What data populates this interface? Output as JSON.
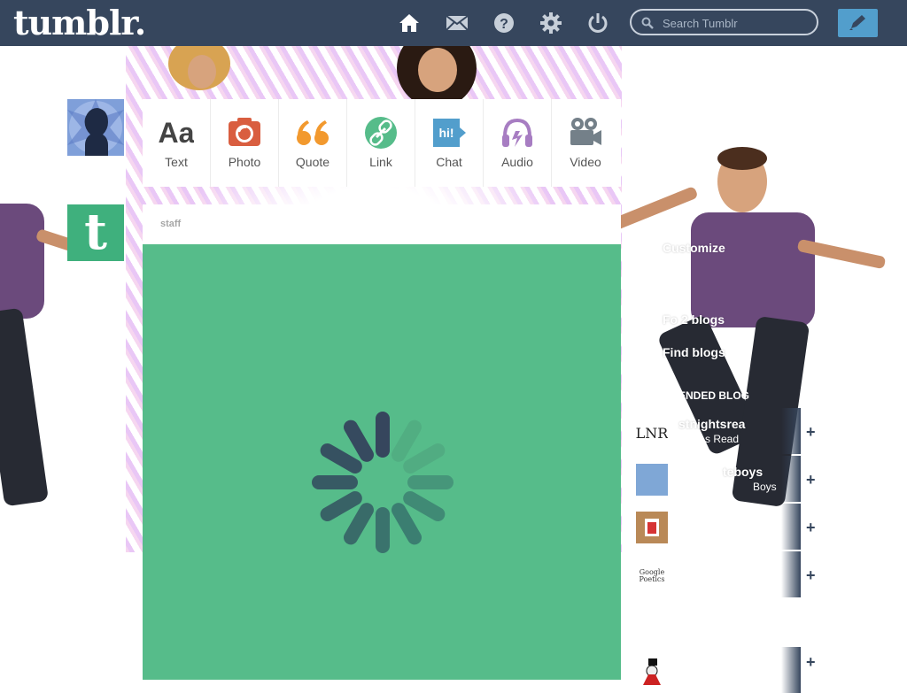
{
  "header": {
    "logo": "tumblr.",
    "icons": [
      "home-icon",
      "mail-icon",
      "help-icon",
      "gear-icon",
      "power-icon"
    ],
    "search_placeholder": "Search Tumblr",
    "post_button_icon": "pencil-icon"
  },
  "composer": {
    "types": [
      {
        "label": "Text",
        "icon": "text-aa-icon",
        "color": "#444444"
      },
      {
        "label": "Photo",
        "icon": "camera-icon",
        "color": "#d95e40"
      },
      {
        "label": "Quote",
        "icon": "quote-icon",
        "color": "#f2992e"
      },
      {
        "label": "Link",
        "icon": "link-icon",
        "color": "#56bc8a"
      },
      {
        "label": "Chat",
        "icon": "chat-icon",
        "color": "#529ecc"
      },
      {
        "label": "Audio",
        "icon": "headphones-icon",
        "color": "#a77dc2"
      },
      {
        "label": "Video",
        "icon": "video-camera-icon",
        "color": "#748089"
      }
    ]
  },
  "post": {
    "author": "staff",
    "body_color": "#56bc8a",
    "state": "loading-spinner"
  },
  "sidebar": {
    "customize": "Customize",
    "following": "Fo       2 blogs",
    "find_blogs": "Find blogs",
    "recommended_heading": "MENDED BLOG",
    "recommended": [
      {
        "name": "stnightsrea",
        "sub": "s Read"
      },
      {
        "name": "teboys",
        "sub": "Boys"
      },
      {
        "name": "",
        "sub": ""
      },
      {
        "name": "",
        "sub": ""
      },
      {
        "name": "",
        "sub": ""
      }
    ],
    "follow_glyph": "+"
  },
  "colors": {
    "header": "#36465d",
    "accent_blue": "#529ecc",
    "staff_green": "#56bc8a"
  }
}
